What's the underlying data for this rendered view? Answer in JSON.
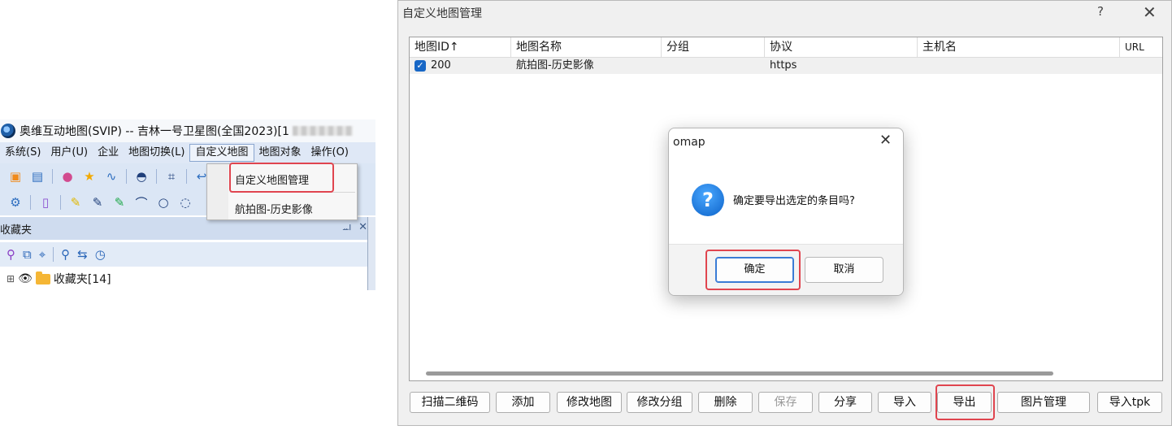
{
  "app": {
    "title": "奥维互动地图(SVIP) -- 吉林一号卫星图(全国2023)[1",
    "menus": [
      "系统(S)",
      "用户(U)",
      "企业",
      "地图切换(L)",
      "自定义地图",
      "地图对象",
      "操作(O)"
    ],
    "dropdown": {
      "items": [
        "自定义地图管理",
        "航拍图-历史影像"
      ]
    },
    "panel": {
      "title": "收藏夹",
      "pin_glyph": "ᆈ",
      "close_glyph": "✕",
      "tree_expander": "⊞",
      "tree_item": "收藏夹[14]"
    }
  },
  "window": {
    "title": "自定义地图管理",
    "help_glyph": "?",
    "close_glyph": "✕",
    "columns": [
      "地图ID↑",
      "地图名称",
      "分组",
      "协议",
      "主机名",
      "URL"
    ],
    "rows": [
      {
        "checked": true,
        "id": "200",
        "name": "航拍图-历史影像",
        "group": "",
        "protocol": "https",
        "host": "",
        "url": ""
      }
    ],
    "buttons": [
      "扫描二维码",
      "添加",
      "修改地图",
      "修改分组",
      "删除",
      "保存",
      "分享",
      "导入",
      "导出",
      "图片管理",
      "导入tpk"
    ]
  },
  "modal": {
    "title": "omap",
    "close_glyph": "✕",
    "icon_glyph": "?",
    "message": "确定要导出选定的条目吗?",
    "ok_label": "确定",
    "cancel_label": "取消"
  },
  "colors": {
    "highlight_box": "#e0454f",
    "menubar": "#dfe8f6",
    "checkbox": "#1767c6"
  }
}
